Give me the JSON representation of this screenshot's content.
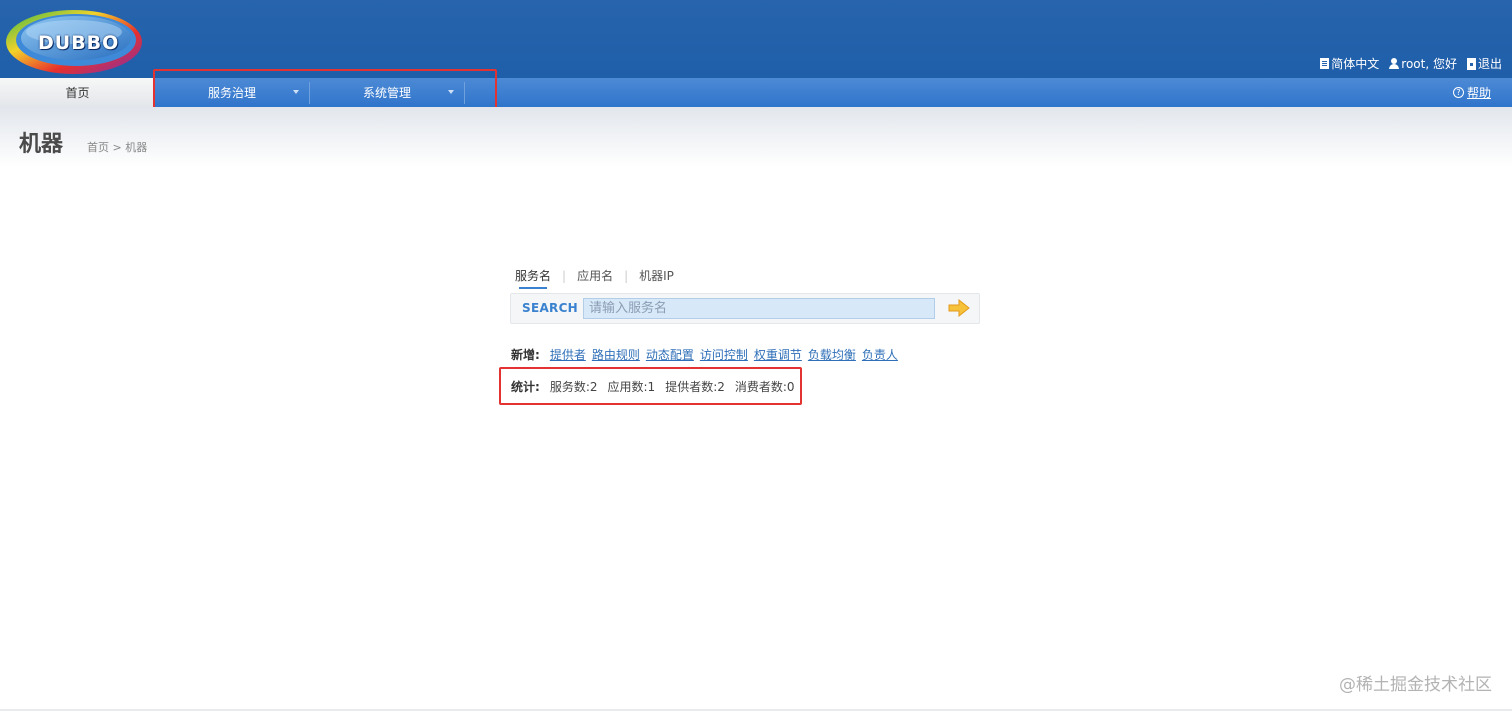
{
  "header": {
    "logo_text": "DUBBO",
    "language": "简体中文",
    "user_greeting": "root, 您好",
    "logout": "退出"
  },
  "nav": {
    "home": "首页",
    "menus": [
      {
        "label": "服务治理"
      },
      {
        "label": "系统管理"
      }
    ],
    "help": "帮助"
  },
  "page": {
    "title": "机器",
    "breadcrumb": "首页 > 机器"
  },
  "search": {
    "tabs": [
      "服务名",
      "应用名",
      "机器IP"
    ],
    "active_tab": "服务名",
    "label": "SEARCH",
    "placeholder": "请输入服务名"
  },
  "add": {
    "label": "新增:",
    "links": [
      "提供者",
      "路由规则",
      "动态配置",
      "访问控制",
      "权重调节",
      "负载均衡",
      "负责人"
    ]
  },
  "stats": {
    "label": "统计:",
    "items": [
      "服务数:2",
      "应用数:1",
      "提供者数:2",
      "消费者数:0"
    ]
  },
  "watermark": "@稀土掘金技术社区",
  "colors": {
    "header_bg": "#2764ad",
    "nav_bg": "#3a7fd0",
    "link": "#2f6fb8",
    "highlight_box": "#e23232"
  }
}
